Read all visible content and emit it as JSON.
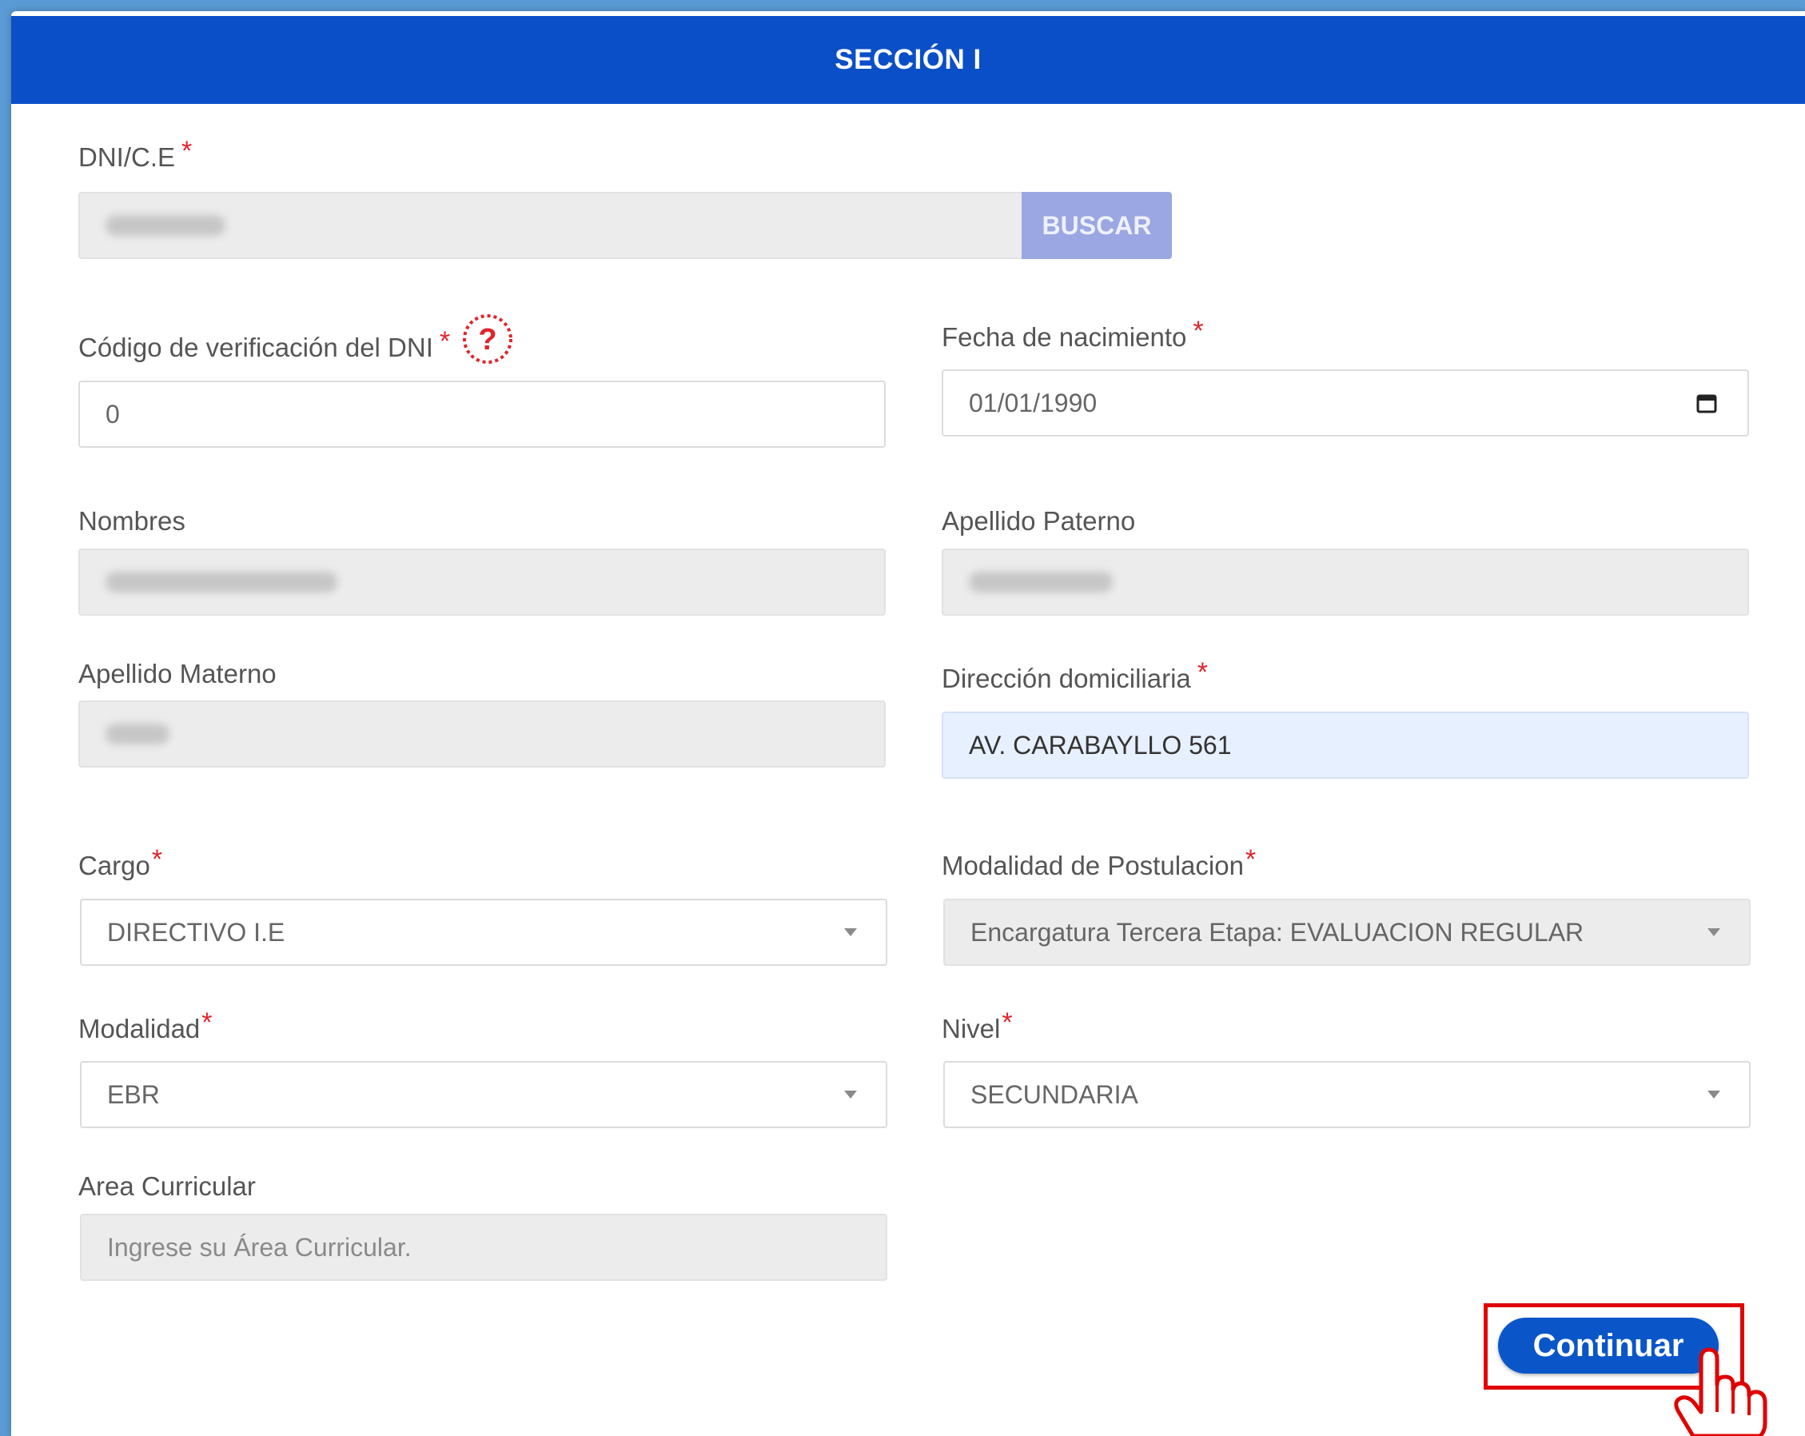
{
  "section": {
    "title": "SECCIÓN I"
  },
  "dni": {
    "label": "DNI/C.E",
    "required": "*",
    "button": "BUSCAR"
  },
  "codigo": {
    "label": "Código de verificación del DNI",
    "required": "*",
    "value": "0"
  },
  "fecha": {
    "label": "Fecha de nacimiento",
    "required": "*",
    "value": "01/01/1990"
  },
  "nombres": {
    "label": "Nombres"
  },
  "apellido_paterno": {
    "label": "Apellido Paterno"
  },
  "apellido_materno": {
    "label": "Apellido Materno"
  },
  "direccion": {
    "label": "Dirección domiciliaria",
    "required": "*",
    "value": "AV. CARABAYLLO 561"
  },
  "cargo": {
    "label": "Cargo",
    "required": "*",
    "value": "DIRECTIVO I.E"
  },
  "modalidad_postulacion": {
    "label": "Modalidad de Postulacion",
    "required": "*",
    "value": "Encargatura Tercera Etapa: EVALUACION REGULAR"
  },
  "modalidad": {
    "label": "Modalidad",
    "required": "*",
    "value": "EBR"
  },
  "nivel": {
    "label": "Nivel",
    "required": "*",
    "value": "SECUNDARIA"
  },
  "area": {
    "label": "Area Curricular",
    "placeholder": "Ingrese su Área Curricular."
  },
  "actions": {
    "continue": "Continuar"
  },
  "icons": {
    "help": "question-circle-icon",
    "calendar": "calendar-icon",
    "caret": "chevron-down-icon",
    "pointer": "hand-pointer-icon"
  },
  "colors": {
    "header": "#0b4fc8",
    "required": "#e0242b",
    "button": "#0a56c9",
    "highlight": "#e00000"
  }
}
